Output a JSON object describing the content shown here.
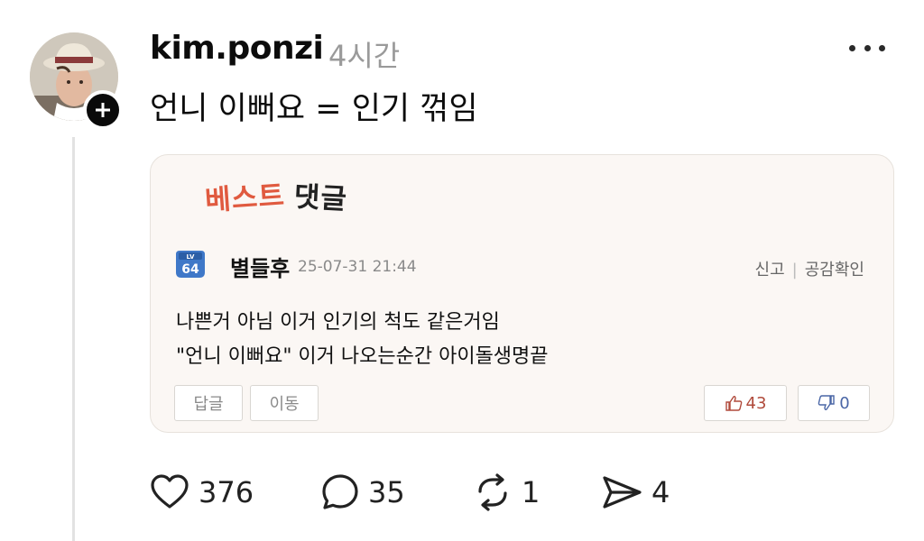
{
  "post": {
    "username": "kim.ponzi",
    "time": "4시간",
    "text": "언니 이뻐요 = 인기 꺾임"
  },
  "card": {
    "banner_red": "베스트",
    "banner_black": "댓글",
    "comment": {
      "level": "64",
      "author": "별들후",
      "date": "25-07-31 21:44",
      "report": "신고",
      "sympathy": "공감확인",
      "lines": [
        "나쁜거 아님 이거 인기의 척도 같은거임",
        "\"언니 이뻐요\" 이거 나오는순간 아이돌생명끝"
      ],
      "reply_label": "답글",
      "move_label": "이동",
      "likes": "43",
      "dislikes": "0"
    }
  },
  "actions": {
    "likes": "376",
    "comments": "35",
    "reposts": "1",
    "shares": "4"
  },
  "colors": {
    "accent_red": "#e05a3f",
    "like_red": "#b04a3b",
    "dislike_blue": "#4a66a6"
  }
}
